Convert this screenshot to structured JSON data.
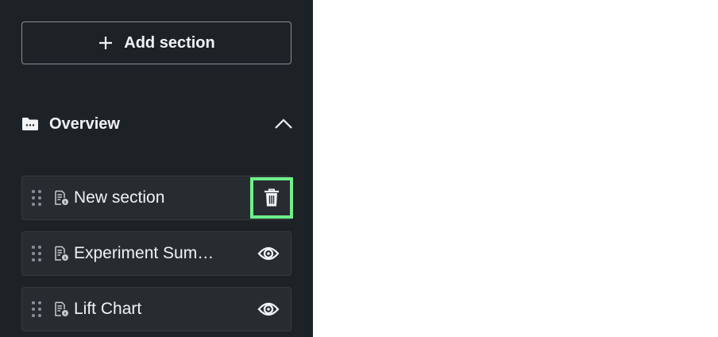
{
  "sidebar": {
    "add_section_label": "Add section",
    "group": {
      "title": "Overview"
    },
    "items": [
      {
        "label": "New section",
        "action_icon": "trash-icon"
      },
      {
        "label": "Experiment Sum…",
        "action_icon": "eye-icon"
      },
      {
        "label": "Lift Chart",
        "action_icon": "eye-icon"
      }
    ]
  },
  "colors": {
    "sidebar_bg": "#1d2226",
    "item_bg": "#272c31",
    "text": "#f1f3f5",
    "highlight": "#6ff08a"
  }
}
